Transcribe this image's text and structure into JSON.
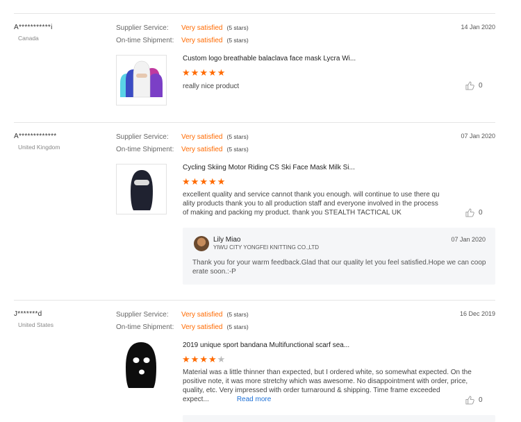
{
  "rating_labels": {
    "service": "Supplier Service:",
    "shipment": "On-time Shipment:"
  },
  "reviews": [
    {
      "user": "A***********i",
      "country": "Canada",
      "date": "14 Jan 2020",
      "service_value": "Very satisfied",
      "service_stars": "(5 stars)",
      "shipment_value": "Very satisfied",
      "shipment_stars": "(5 stars)",
      "product_title": "Custom logo breathable balaclava face mask Lycra Wi...",
      "rating": 5,
      "text": "really nice product",
      "likes": "0"
    },
    {
      "user": "A*************",
      "country": "United Kingdom",
      "date": "07 Jan 2020",
      "service_value": "Very satisfied",
      "service_stars": "(5 stars)",
      "shipment_value": "Very satisfied",
      "shipment_stars": "(5 stars)",
      "product_title": "Cycling Skiing Motor Riding CS Ski Face Mask Milk Si...",
      "rating": 5,
      "text": "excellent quality and service cannot thank you enough. will continue to use there quality products thank you to all production staff and everyone involved in the process of making and packing my product. thank you STEALTH TACTICAL UK",
      "likes": "0",
      "reply": {
        "name": "Lily Miao",
        "company": "YIWU CITY YONGFEI KNITTING CO.,LTD",
        "date": "07 Jan 2020",
        "text": "Thank you for your warm feedback.Glad that our quality let you feel satisfied.Hope we can cooperate soon.:-P"
      }
    },
    {
      "user": "J*******d",
      "country": "United States",
      "date": "16 Dec 2019",
      "service_value": "Very satisfied",
      "service_stars": "(5 stars)",
      "shipment_value": "Very satisfied",
      "shipment_stars": "(5 stars)",
      "product_title": "2019 unique sport bandana Multifunctional scarf sea...",
      "rating": 4,
      "text": "Material was a little thinner than expected, but I ordered white, so somewhat expected. On the positive note, it was more stretchy which was awesome. No disappointment with order, price, quality, etc. Very impressed with order turnaround & shipping. Time frame exceeded expect...",
      "read_more": "Read more",
      "likes": "0"
    }
  ],
  "colors": {
    "accent": "#ff6a00",
    "link": "#1b6fd6"
  },
  "icons": {
    "like": "thumbs-up-icon",
    "star": "star-icon"
  }
}
